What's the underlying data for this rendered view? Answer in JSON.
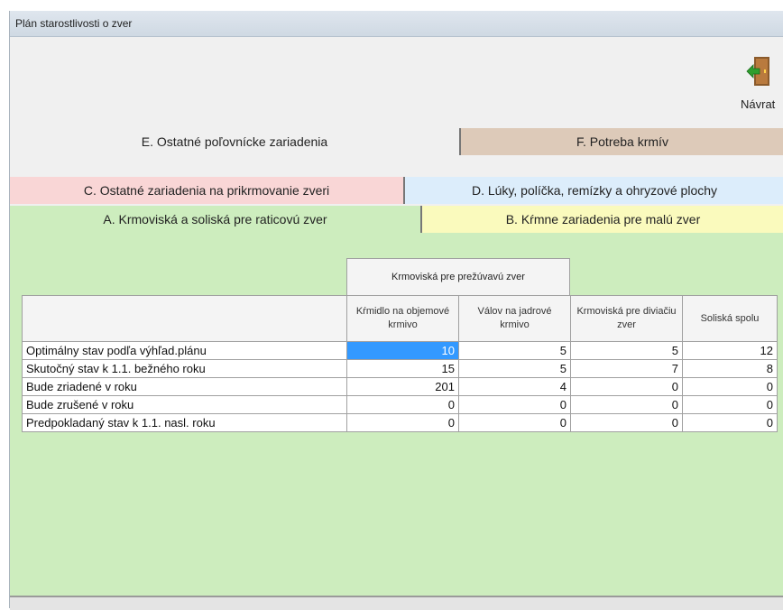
{
  "window": {
    "title": "Plán starostlivosti o zver"
  },
  "toolbar": {
    "back_label": "Návrat"
  },
  "tabs": {
    "e": "E. Ostatné poľovnícke zariadenia",
    "f": "F. Potreba krmív",
    "c": "C. Ostatné zariadenia na prikrmovanie zveri",
    "d": "D. Lúky, políčka, remízky a ohryzové plochy",
    "a": "A. Krmoviská a soliská pre raticovú zver",
    "b": "B. Kŕmne zariadenia pre malú zver"
  },
  "table": {
    "group_header": "Krmoviská pre prežúvavú zver",
    "columns": [
      "",
      "Kŕmidlo na objemové krmivo",
      "Válov na jadrové krmivo",
      "Krmoviská pre diviačiu zver",
      "Soliská spolu"
    ],
    "rows": [
      {
        "label": "Optimálny stav podľa výhľad.plánu",
        "values": [
          "10",
          "5",
          "5",
          "12"
        ]
      },
      {
        "label": "Skutočný stav k 1.1. bežného roku",
        "values": [
          "15",
          "5",
          "7",
          "8"
        ]
      },
      {
        "label": "Bude zriadené v roku",
        "values": [
          "201",
          "4",
          "0",
          "0"
        ]
      },
      {
        "label": "Bude zrušené v roku",
        "values": [
          "0",
          "0",
          "0",
          "0"
        ]
      },
      {
        "label": "Predpokladaný stav k 1.1. nasl. roku",
        "values": [
          "0",
          "0",
          "0",
          "0"
        ]
      }
    ]
  },
  "icons": {
    "back": "exit-door-icon"
  },
  "colors": {
    "tab_e": "#f0f0f0",
    "tab_f": "#ddcab9",
    "tab_c": "#f9d6d6",
    "tab_d": "#dcedfb",
    "tab_a": "#cdedbe",
    "tab_b": "#fafabd",
    "selection": "#3399ff"
  }
}
